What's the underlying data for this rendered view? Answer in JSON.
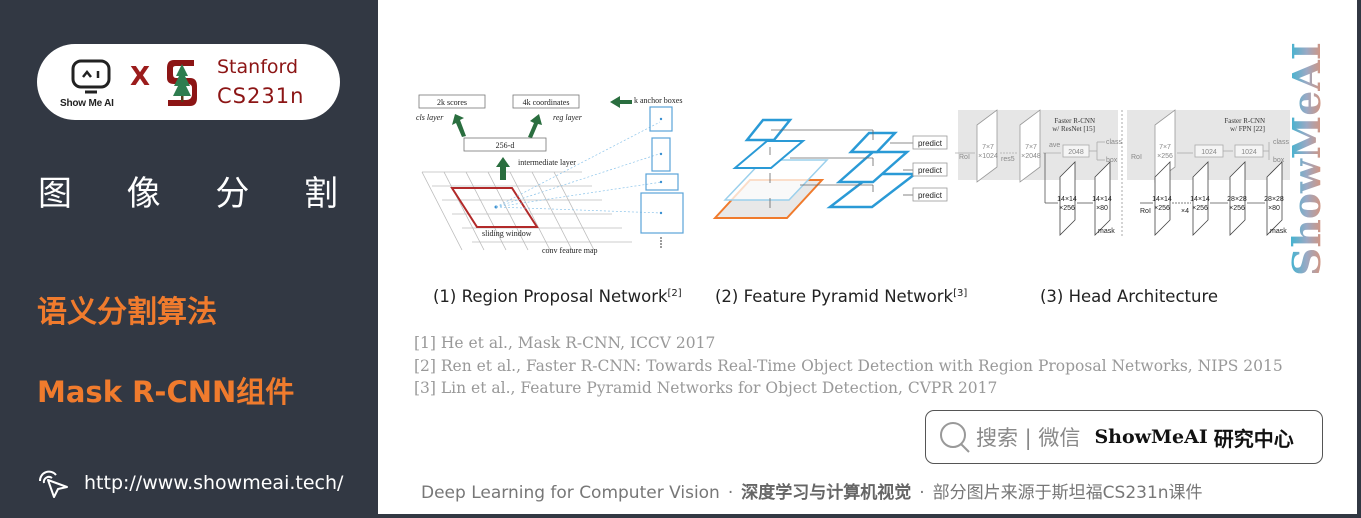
{
  "sidebar": {
    "logo": {
      "showmeai_label": "Show Me AI",
      "times": "X",
      "stanford_name": "Stanford",
      "stanford_course": "CS231n"
    },
    "section_title_chars": [
      "图",
      "像",
      "分",
      "割"
    ],
    "topics": [
      "语义分割算法",
      "Mask R-CNN组件"
    ],
    "url": "http://www.showmeai.tech/"
  },
  "slide": {
    "figures": {
      "rpn": {
        "box_scores": "2k scores",
        "box_coords": "4k coordinates",
        "cls_layer": "cls layer",
        "reg_layer": "reg layer",
        "intermediate_box": "256-d",
        "intermediate_label": "intermediate layer",
        "anchor_label": "k anchor boxes",
        "sliding_window": "sliding window",
        "feature_map": "conv feature map"
      },
      "fpn": {
        "predict_labels": [
          "predict",
          "predict",
          "predict"
        ]
      },
      "head": {
        "left_title_1": "Faster R-CNN",
        "left_title_2": "w/ ResNet [15]",
        "right_title_1": "Faster R-CNN",
        "right_title_2": "w/ FPN [22]",
        "roi": "RoI",
        "l_block1_a": "7×7",
        "l_block1_b": "×1024",
        "res5": "res5",
        "l_block2_a": "7×7",
        "l_block2_b": "×2048",
        "ave": "ave",
        "fc_2048": "2048",
        "class": "class",
        "box": "box",
        "l_mask1_a": "14×14",
        "l_mask1_b": "×256",
        "l_mask2_a": "14×14",
        "l_mask2_b": "×80",
        "mask": "mask",
        "r_block1_a": "7×7",
        "r_block1_b": "×256",
        "fc_1024": "1024",
        "r_m1_a": "14×14",
        "r_m1_b": "×256",
        "x4": "×4",
        "r_m2_a": "14×14",
        "r_m2_b": "×256",
        "r_m3_a": "28×28",
        "r_m3_b": "×256",
        "r_m4_a": "28×28",
        "r_m4_b": "×80"
      }
    },
    "captions": [
      {
        "num": "(1)",
        "text": "Region Proposal Network",
        "ref": "[2]"
      },
      {
        "num": "(2)",
        "text": "Feature Pyramid Network",
        "ref": "[3]"
      },
      {
        "num": "(3)",
        "text": "Head Architecture",
        "ref": ""
      }
    ],
    "references": [
      "[1] He et al., Mask R-CNN, ICCV 2017",
      "[2] Ren et al., Faster R-CNN: Towards Real-Time Object Detection with Region Proposal Networks, NIPS 2015",
      "[3] Lin et al., Feature Pyramid Networks for Object Detection, CVPR 2017"
    ],
    "watermark": "ShowMeAI",
    "search": {
      "label": "搜索 | 微信",
      "brand": "ShowMeAI",
      "brand_cn": "研究中心"
    },
    "footer": {
      "en": "Deep Learning for Computer Vision",
      "dot": "·",
      "cn_bold": "深度学习与计算机视觉",
      "source": "部分图片来源于斯坦福CS231n课件"
    }
  }
}
